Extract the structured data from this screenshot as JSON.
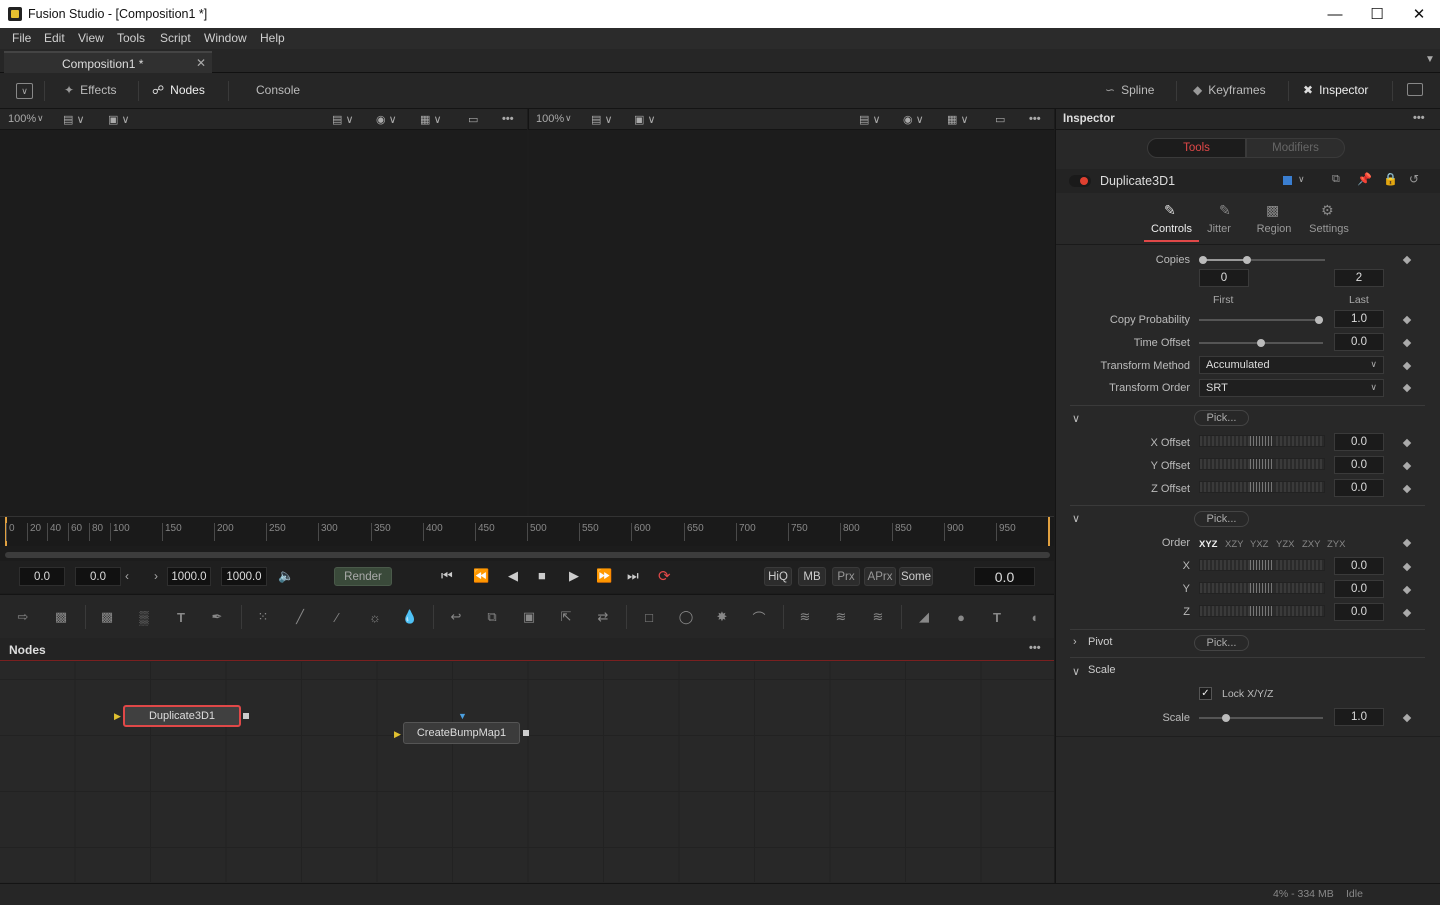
{
  "window": {
    "title": "Fusion Studio - [Composition1 *]"
  },
  "menu": [
    "File",
    "Edit",
    "View",
    "Tools",
    "Script",
    "Window",
    "Help"
  ],
  "tabs": [
    {
      "label": "Composition1 *"
    }
  ],
  "toolbar": {
    "effects": "Effects",
    "nodes": "Nodes",
    "console": "Console",
    "spline": "Spline",
    "keyframes": "Keyframes",
    "inspector": "Inspector"
  },
  "viewer1": {
    "zoom": "100%"
  },
  "viewer2": {
    "zoom": "100%"
  },
  "ruler": {
    "ticks": [
      "0",
      "20",
      "40",
      "60",
      "80",
      "100",
      "150",
      "200",
      "250",
      "300",
      "350",
      "400",
      "450",
      "500",
      "550",
      "600",
      "650",
      "700",
      "750",
      "800",
      "850",
      "900",
      "950"
    ]
  },
  "transport": {
    "start": "0.0",
    "current_start": "0.0",
    "end": "1000.0",
    "global_end": "1000.0",
    "render": "Render",
    "hiq": "HiQ",
    "mb": "MB",
    "prx": "Prx",
    "aprx": "APrx",
    "some": "Some",
    "time": "0.0"
  },
  "nodes_panel": {
    "title": "Nodes"
  },
  "nodes": [
    {
      "name": "Duplicate3D1",
      "selected": true
    },
    {
      "name": "CreateBumpMap1",
      "selected": false
    }
  ],
  "status": {
    "memory": "4% - 334 MB",
    "state": "Idle"
  },
  "inspector": {
    "title": "Inspector",
    "tab_tools": "Tools",
    "tab_modifiers": "Modifiers",
    "tool_name": "Duplicate3D1",
    "subtabs": [
      "Controls",
      "Jitter",
      "Region",
      "Settings"
    ],
    "copies_label": "Copies",
    "first_value": "0",
    "last_value": "2",
    "first_label": "First",
    "last_label": "Last",
    "copy_probability_label": "Copy Probability",
    "copy_probability": "1.0",
    "time_offset_label": "Time Offset",
    "time_offset": "0.0",
    "transform_method_label": "Transform Method",
    "transform_method": "Accumulated",
    "transform_order_label": "Transform Order",
    "transform_order": "SRT",
    "pick": "Pick...",
    "x_offset_label": "X Offset",
    "x_offset": "0.0",
    "y_offset_label": "Y Offset",
    "y_offset": "0.0",
    "z_offset_label": "Z Offset",
    "z_offset": "0.0",
    "order_label": "Order",
    "orders": [
      "XYZ",
      "XZY",
      "YXZ",
      "YZX",
      "ZXY",
      "ZYX"
    ],
    "x_label": "X",
    "x": "0.0",
    "y_label": "Y",
    "y": "0.0",
    "z_label": "Z",
    "z": "0.0",
    "pivot_label": "Pivot",
    "scale_section": "Scale",
    "lock_label": "Lock X/Y/Z",
    "scale_label": "Scale",
    "scale": "1.0"
  },
  "colors": {
    "accent": "#d04040",
    "panel": "#282828",
    "selected_node": "#e04848"
  }
}
